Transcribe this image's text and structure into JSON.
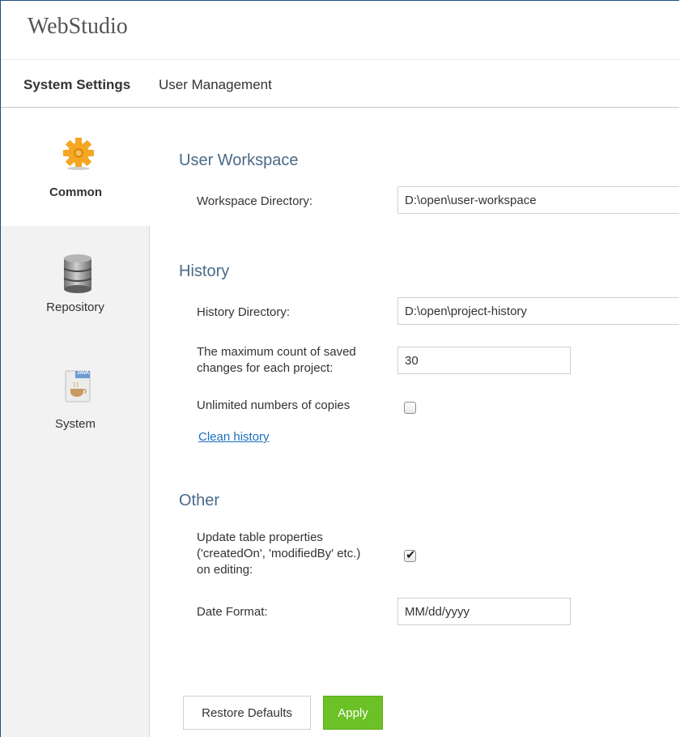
{
  "app": {
    "title": "WebStudio"
  },
  "tabs": [
    {
      "label": "System Settings",
      "active": true
    },
    {
      "label": "User Management",
      "active": false
    }
  ],
  "sidebar": {
    "items": [
      {
        "label": "Common",
        "icon": "gear-icon",
        "active": true
      },
      {
        "label": "Repository",
        "icon": "database-icon",
        "active": false
      },
      {
        "label": "System",
        "icon": "java-icon",
        "badge": "JAVA",
        "active": false
      }
    ]
  },
  "colors": {
    "accent": "#f5a623",
    "section": "#4a6a87",
    "link": "#1a6fc0",
    "apply": "#6bc125"
  },
  "workspace": {
    "title": "User Workspace",
    "dir_label": "Workspace Directory:",
    "dir_value": "D:\\open\\user-workspace"
  },
  "history": {
    "title": "History",
    "dir_label": "History Directory:",
    "dir_value": "D:\\open\\project-history",
    "max_label_1": "The maximum count of saved",
    "max_label_2": "changes for each project:",
    "max_value": "30",
    "unlimited_label": "Unlimited numbers of copies",
    "unlimited_checked": false,
    "clean_link": "Clean history"
  },
  "other": {
    "title": "Other",
    "update_label_1": "Update table properties",
    "update_label_2": "('createdOn', 'modifiedBy' etc.)",
    "update_label_3": "on editing:",
    "update_checked": true,
    "date_label": "Date Format:",
    "date_value": "MM/dd/yyyy"
  },
  "buttons": {
    "restore": "Restore Defaults",
    "apply": "Apply"
  }
}
